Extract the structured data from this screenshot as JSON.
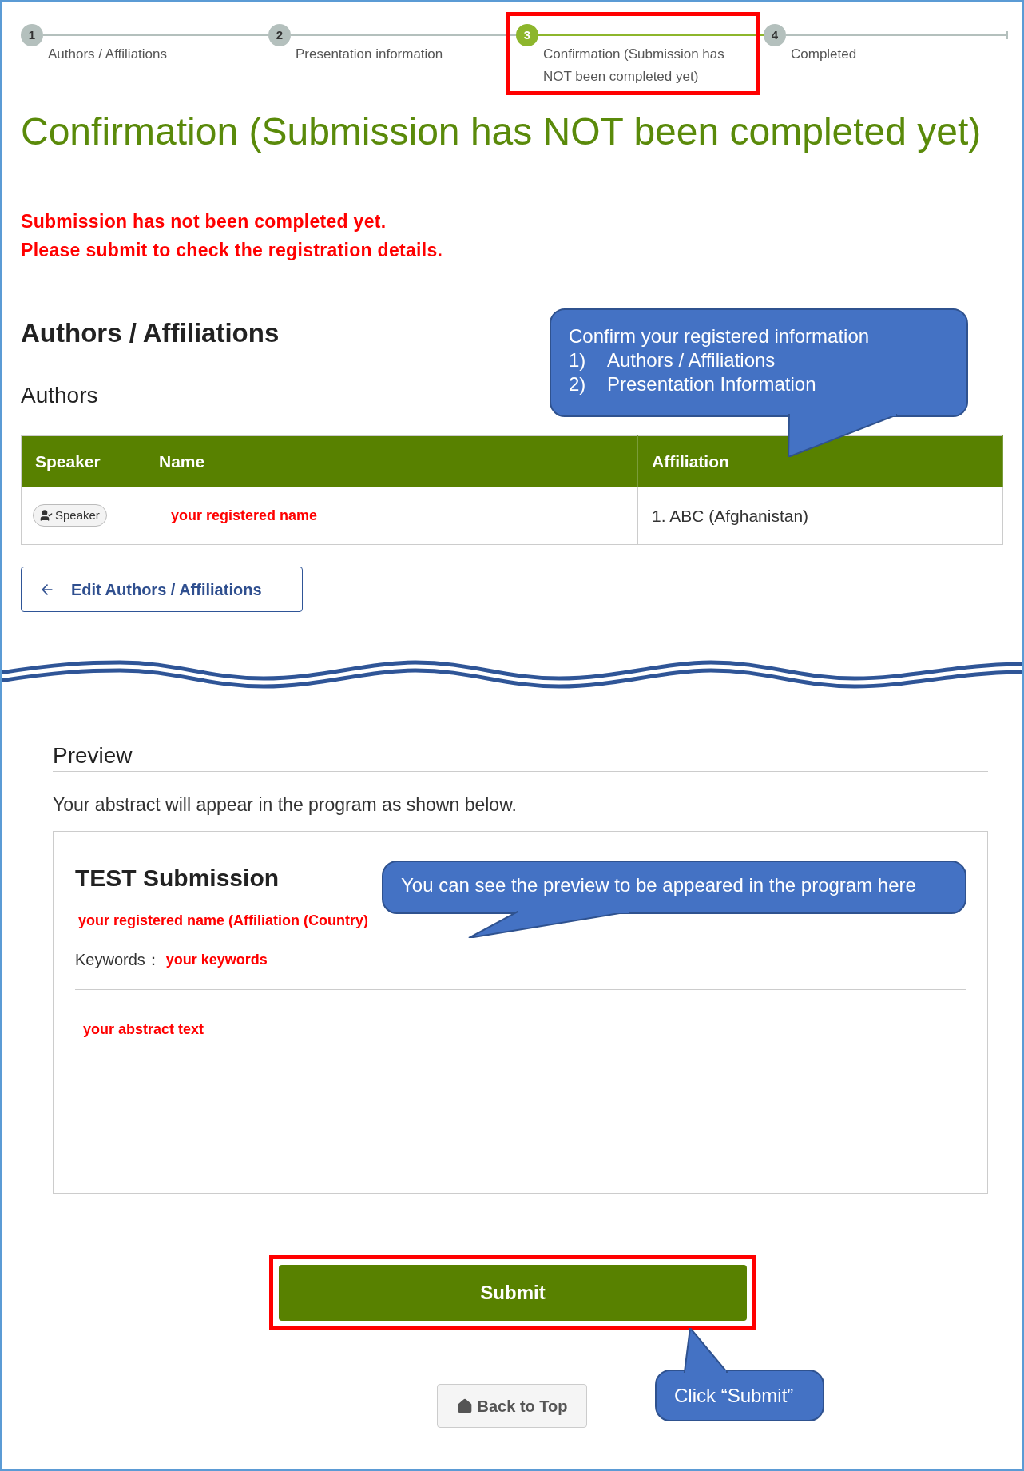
{
  "steps": [
    {
      "number": "1",
      "label": "Authors / Affiliations",
      "selected": false,
      "highlighted": false
    },
    {
      "number": "2",
      "label": "Presentation information",
      "selected": false,
      "highlighted": false
    },
    {
      "number": "3",
      "label": "Confirmation (Submission has NOT been completed yet)",
      "selected": true,
      "highlighted": true
    },
    {
      "number": "4",
      "label": "Completed",
      "selected": false,
      "highlighted": false
    }
  ],
  "title": "Confirmation (Submission has NOT been completed yet)",
  "warnings": [
    "Submission has not been completed yet.",
    "Please submit to check the registration details."
  ],
  "section_title": "Authors / Affiliations",
  "authors": {
    "heading": "Authors",
    "columns": [
      "Speaker",
      "Name",
      "Affiliation"
    ],
    "rows": [
      {
        "speaker_badge": "Speaker",
        "name": "your registered name",
        "affiliation": "1. ABC (Afghanistan)"
      }
    ]
  },
  "edit_button": "Edit Authors / Affiliations",
  "preview": {
    "heading": "Preview",
    "intro": "Your abstract will appear in the program as shown below.",
    "title": "TEST Submission",
    "authors": "your registered name (Affiliation (Country)",
    "keywords_label": "Keywords：",
    "keywords": "your keywords",
    "abstract": "your abstract text"
  },
  "submit": {
    "label": "Submit",
    "highlighted": true
  },
  "back_button": "Back to Top",
  "annotations": [
    {
      "kind": "callout",
      "lines": [
        {
          "text": "Confirm your registered information"
        },
        {
          "number": "1)",
          "text": "Authors / Affiliations"
        },
        {
          "number": "2)",
          "text": "Presentation Information"
        }
      ]
    },
    {
      "kind": "callout",
      "lines": [
        {
          "text": "You can see the preview to be appeared in the program here"
        }
      ]
    },
    {
      "kind": "callout",
      "lines": [
        {
          "text": "Click “Submit”"
        }
      ]
    }
  ]
}
